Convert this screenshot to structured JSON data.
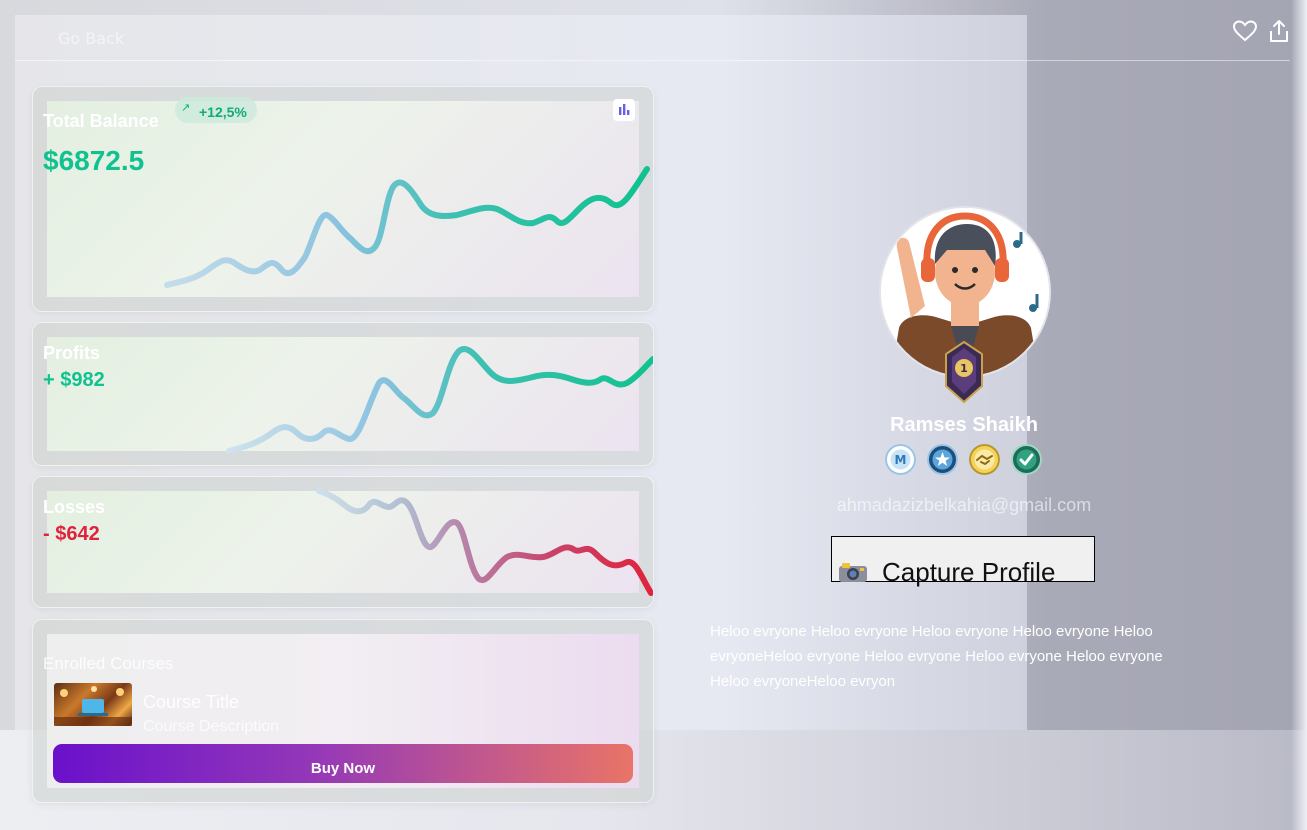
{
  "header": {
    "back_label": "Go Back",
    "like_icon": "heart-icon",
    "share_icon": "share-icon"
  },
  "balance_card": {
    "title": "Total Balance",
    "value": "$6872.5",
    "change": "+12,5%",
    "chart_icon": "bar-chart-icon"
  },
  "profits_card": {
    "title": "Profits",
    "value": "+ $982"
  },
  "losses_card": {
    "title": "Losses",
    "value": "- $642"
  },
  "courses_card": {
    "title": "Enrolled Courses",
    "course_title": "Course Title",
    "course_description": "Course Description",
    "buy_label": "Buy Now"
  },
  "profile": {
    "name": "Ramses Shaikh",
    "rank": "1",
    "email": "ahmadazizbelkahia@gmail.com",
    "capture_label": "Capture Profile",
    "bio": "Heloo evryone Heloo evryone Heloo evryone Heloo evryone Heloo evryoneHeloo evryone Heloo evryone Heloo evryone Heloo evryone Heloo evryoneHeloo evryon",
    "badges": [
      "m-badge",
      "star-badge",
      "handshake-badge",
      "check-badge"
    ]
  },
  "colors": {
    "profit_green": "#0fc28f",
    "loss_red": "#e0233c",
    "buy_gradient_start": "#6a11cb",
    "buy_gradient_end": "#e97467"
  }
}
